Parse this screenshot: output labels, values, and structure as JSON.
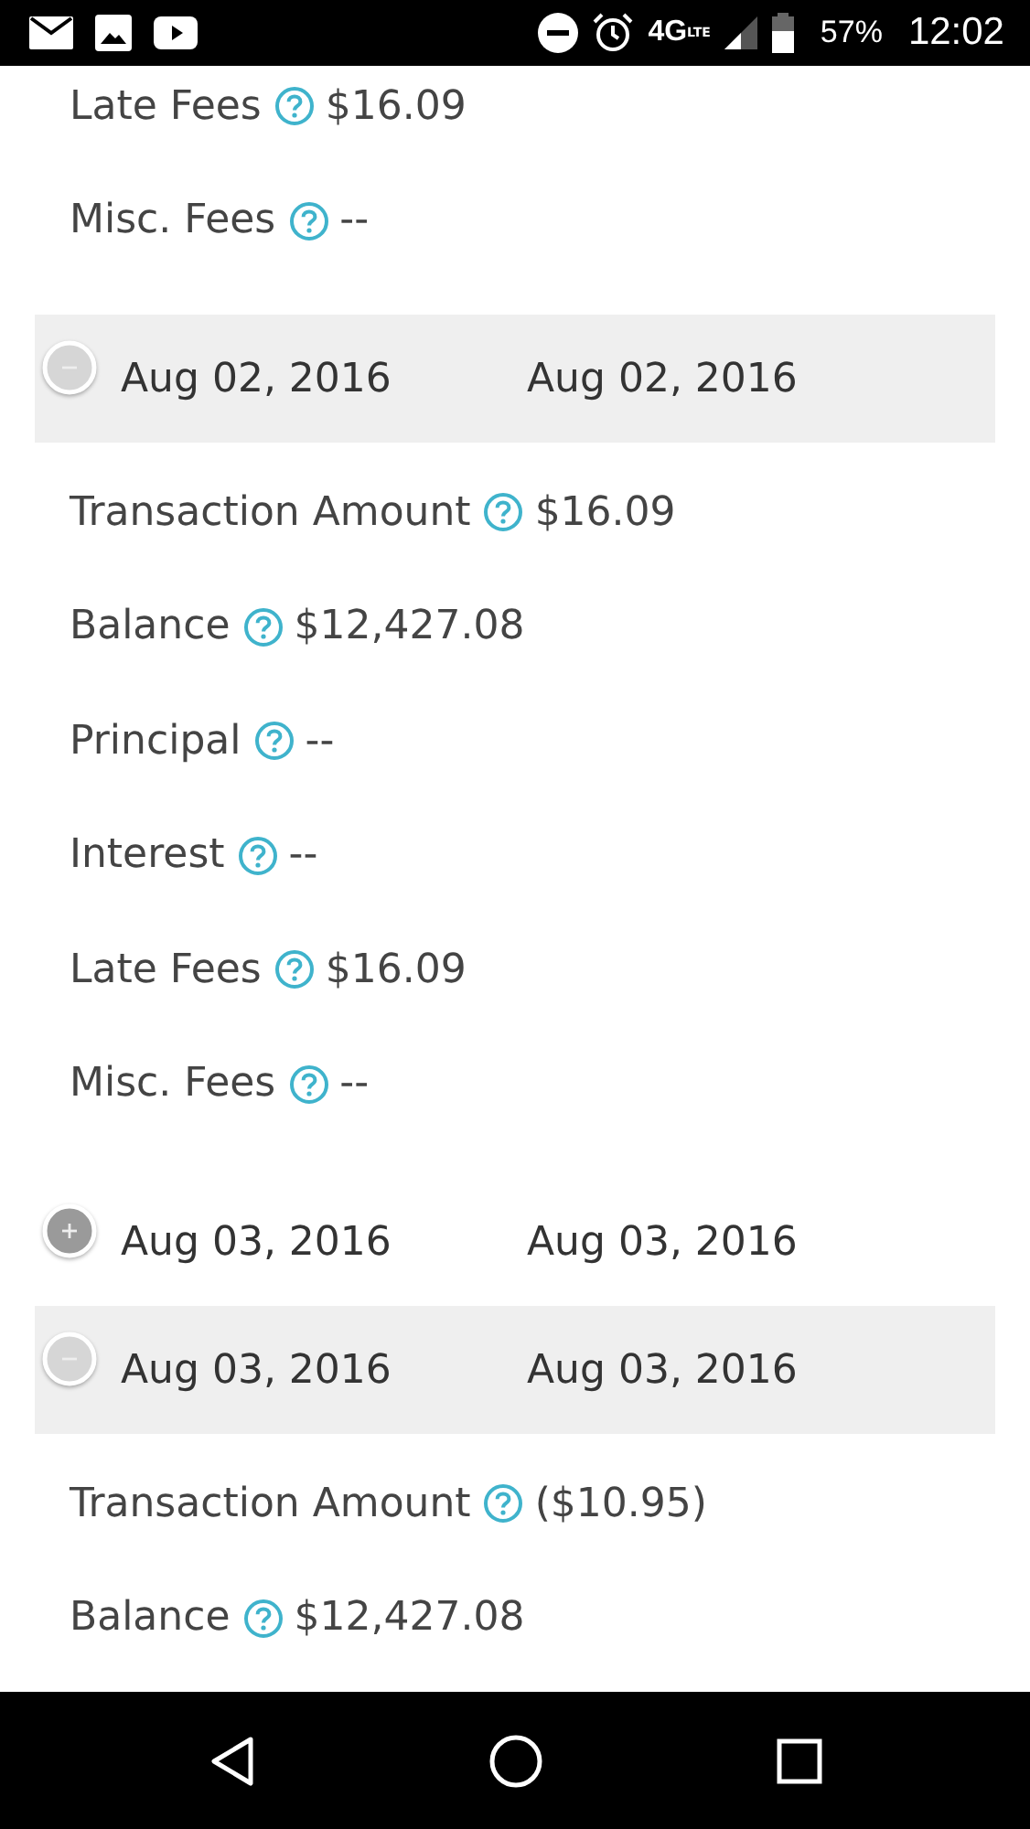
{
  "status_bar": {
    "network": "4G",
    "network_sub": "LTE",
    "battery": "57%",
    "time": "12:02"
  },
  "rows": [
    {
      "kind": "field",
      "label": "Late Fees",
      "value": "$16.09"
    },
    {
      "kind": "field",
      "label": "Misc. Fees",
      "value": "--"
    },
    {
      "kind": "header",
      "expanded": true,
      "date_1": "Aug 02, 2016",
      "date_2": "Aug 02, 2016"
    },
    {
      "kind": "field",
      "label": "Transaction Amount",
      "value": "$16.09"
    },
    {
      "kind": "field",
      "label": "Balance",
      "value": "$12,427.08"
    },
    {
      "kind": "field",
      "label": "Principal",
      "value": "--"
    },
    {
      "kind": "field",
      "label": "Interest",
      "value": "--"
    },
    {
      "kind": "field",
      "label": "Late Fees",
      "value": "$16.09"
    },
    {
      "kind": "field",
      "label": "Misc. Fees",
      "value": "--"
    },
    {
      "kind": "header",
      "expanded": false,
      "date_1": "Aug 03, 2016",
      "date_2": "Aug 03, 2016"
    },
    {
      "kind": "header",
      "expanded": true,
      "date_1": "Aug 03, 2016",
      "date_2": "Aug 03, 2016"
    },
    {
      "kind": "field",
      "label": "Transaction Amount",
      "value": "($10.95)"
    },
    {
      "kind": "field",
      "label": "Balance",
      "value": "$12,427.08"
    }
  ]
}
